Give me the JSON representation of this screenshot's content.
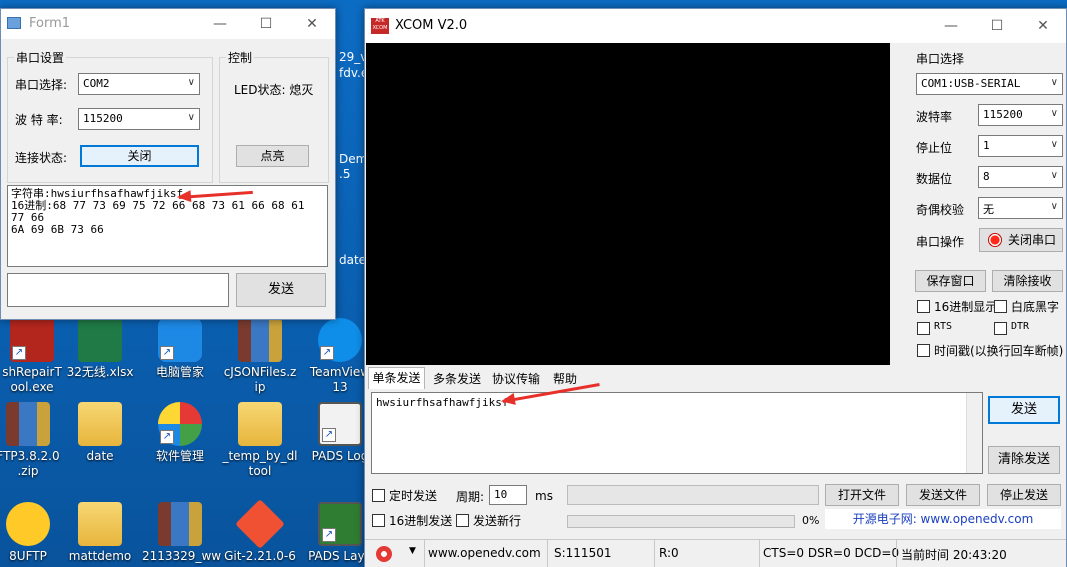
{
  "desktop": {
    "icons": [
      {
        "label": "shRepairT\nool.exe"
      },
      {
        "label": "32无线.xlsx"
      },
      {
        "label": "电脑管家"
      },
      {
        "label": "cJSONFiles.z\nip"
      },
      {
        "label": "TeamView\n13"
      },
      {
        "label": "FTP3.8.2.0\n.zip"
      },
      {
        "label": "date"
      },
      {
        "label": "软件管理"
      },
      {
        "label": "_temp_by_dl\ntool"
      },
      {
        "label": "PADS Log"
      },
      {
        "label": "8UFTP"
      },
      {
        "label": "mattdemo"
      },
      {
        "label": "2113329_ww"
      },
      {
        "label": "Git-2.21.0-6"
      },
      {
        "label": "PADS Layo"
      }
    ],
    "partial_labels": [
      "29_v",
      "fdv.e",
      "Dem",
      ".5",
      "date"
    ]
  },
  "form1": {
    "title": "Form1",
    "serial_group": "串口设置",
    "port_label": "串口选择:",
    "port_value": "COM2",
    "baud_label": "波 特 率:",
    "baud_value": "115200",
    "conn_label": "连接状态:",
    "close_button": "关闭",
    "control_group": "控制",
    "led_status": "LED状态: 熄灭",
    "light_button": "点亮",
    "output_line1": "字符串:hwsiurfhsafhawfjiksf",
    "output_line2": "16进制:68 77 73 69 75 72 66 68 73 61 66 68 61 77 66",
    "output_line3": "6A 69 6B 73 66",
    "input_value": "",
    "send_button": "发送"
  },
  "xcom": {
    "title": "XCOM V2.0",
    "app_icon_text": "ATK\nXCOM",
    "port_select_label": "串口选择",
    "port_value": "COM1:USB-SERIAL",
    "baud_label": "波特率",
    "baud_value": "115200",
    "stop_label": "停止位",
    "stop_value": "1",
    "data_label": "数据位",
    "data_value": "8",
    "parity_label": "奇偶校验",
    "parity_value": "无",
    "op_label": "串口操作",
    "close_port_button": "关闭串口",
    "save_window_button": "保存窗口",
    "clear_receive_button": "清除接收",
    "hex_display": "16进制显示",
    "white_black": "白底黑字",
    "rts": "RTS",
    "dtr": "DTR",
    "timestamp": "时间戳(以换行回车断帧)",
    "tabs": [
      "单条发送",
      "多条发送",
      "协议传输",
      "帮助"
    ],
    "send_text": "hwsiurfhsafhawfjiksf",
    "send_button": "发送",
    "clear_send_button": "清除发送",
    "timed_send": "定时发送",
    "period_label": "周期:",
    "period_value": "10",
    "period_unit": "ms",
    "open_file_button": "打开文件",
    "send_file_button": "发送文件",
    "stop_send_button": "停止发送",
    "hex_send": "16进制发送",
    "send_newline": "发送新行",
    "progress": "0%",
    "progress_value": 0,
    "website_banner": "开源电子网: www.openedv.com",
    "status_url": "www.openedv.com",
    "status_s": "S:111501",
    "status_r": "R:0",
    "status_lines": "CTS=0 DSR=0 DCD=0",
    "status_time": "当前时间 20:43:20"
  },
  "colors": {
    "accent": "#0078d7",
    "arrow": "#e8302a",
    "receive_bg": "#000000",
    "banner_text": "#1a3fbf"
  }
}
